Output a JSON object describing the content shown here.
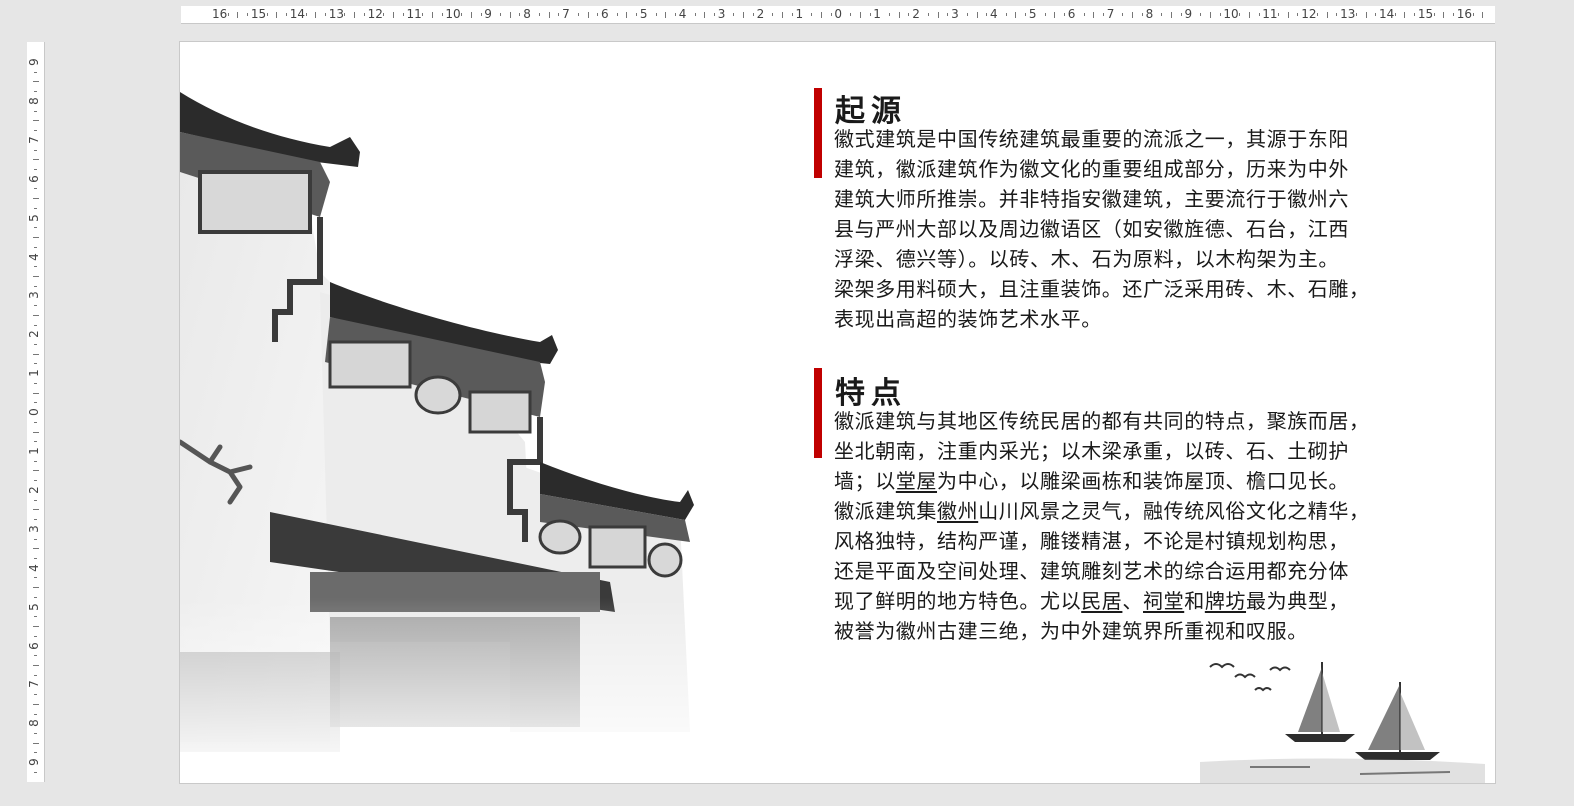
{
  "ruler": {
    "horizontal": [
      "16",
      "15",
      "14",
      "13",
      "12",
      "11",
      "10",
      "9",
      "8",
      "7",
      "6",
      "5",
      "4",
      "3",
      "2",
      "1",
      "0",
      "1",
      "2",
      "3",
      "4",
      "5",
      "6",
      "7",
      "8",
      "9",
      "10",
      "11",
      "12",
      "13",
      "14",
      "15",
      "16"
    ],
    "vertical": [
      "9",
      "8",
      "7",
      "6",
      "5",
      "4",
      "3",
      "2",
      "1",
      "0",
      "1",
      "2",
      "3",
      "4",
      "5",
      "6",
      "7",
      "8",
      "9"
    ]
  },
  "slide": {
    "accent_color": "#c00000",
    "sections": [
      {
        "heading": "起源",
        "lines": [
          "徽式建筑是中国传统建筑最重要的流派之一，其源于东阳",
          "建筑，徽派建筑作为徽文化的重要组成部分，历来为中外",
          "建筑大师所推崇。并非特指安徽建筑，主要流行于徽州六",
          "县与严州大部以及周边徽语区（如安徽旌德、石台，江西",
          "浮梁、德兴等）。以砖、木、石为原料，以木构架为主。",
          "梁架多用料硕大，且注重装饰。还广泛采用砖、木、石雕，",
          "表现出高超的装饰艺术水平。"
        ]
      },
      {
        "heading": "特点",
        "lines": [
          "徽派建筑与其地区传统民居的都有共同的特点，聚族而居，",
          "坐北朝南，注重内采光；以木梁承重，以砖、石、土砌护",
          [
            "墙；以",
            "堂屋",
            "为中心，以雕梁画栋和装饰屋顶、檐口见长。"
          ],
          [
            "徽派建筑集",
            "徽州",
            "山川风景之灵气，融传统风俗文化之精华，"
          ],
          "风格独特，结构严谨，雕镂精湛，不论是村镇规划构思，",
          "还是平面及空间处理、建筑雕刻艺术的综合运用都充分体",
          [
            "现了鲜明的地方特色。尤以",
            "民居",
            "、",
            "祠堂",
            "和",
            "牌坊",
            "最为典型，"
          ],
          "被誉为徽州古建三绝，为中外建筑界所重视和叹服。"
        ]
      }
    ],
    "images": {
      "building": "huizhou-architecture-wall-image",
      "boats": "ink-painting-sailboats-image"
    }
  }
}
